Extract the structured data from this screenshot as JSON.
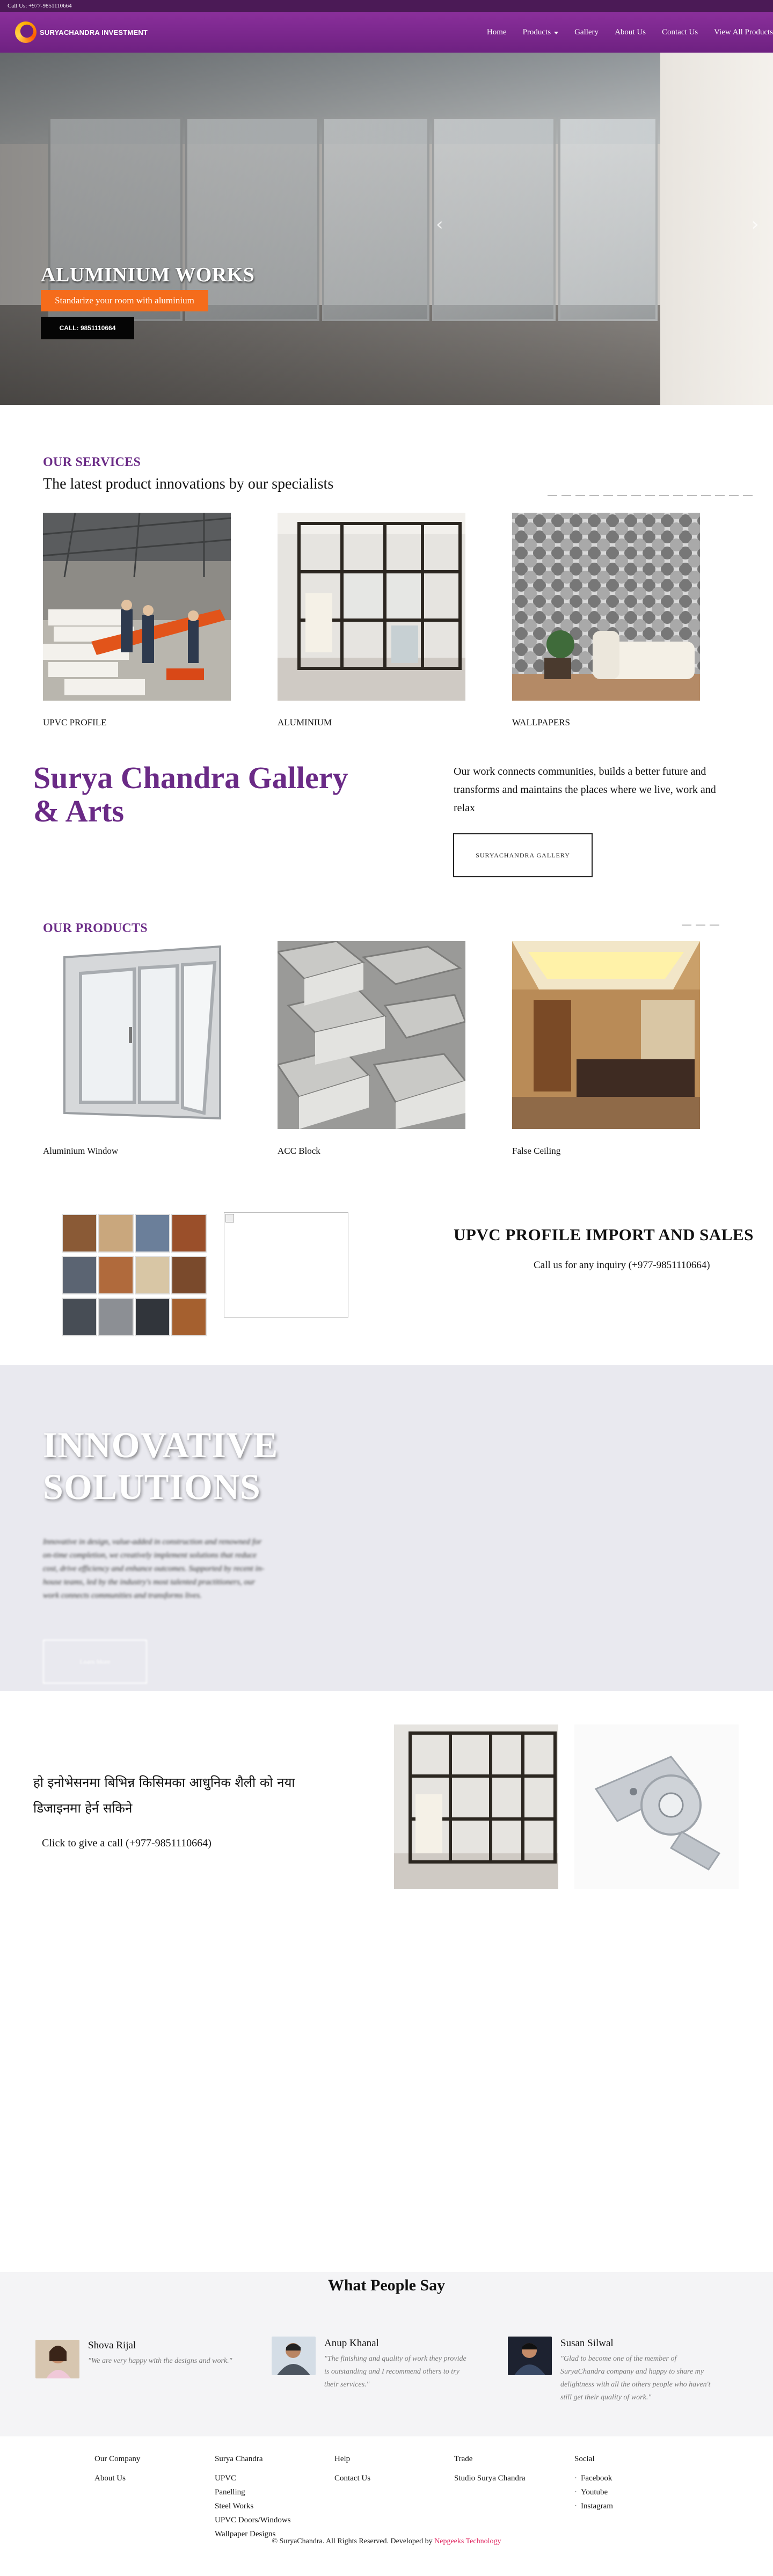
{
  "topbar": {
    "phone": "Call Us: +977-9851110664",
    "social": [
      "",
      "",
      "",
      "",
      "",
      "",
      ""
    ]
  },
  "header": {
    "logo_text": "SURYACHANDRA INVESTMENT",
    "nav": [
      "Home",
      "Products",
      "Gallery",
      "About Us",
      "Contact Us",
      "View All Products"
    ]
  },
  "hero": {
    "title": "ALUMINIUM WORKS",
    "tagline": "Standarize your room with aluminium",
    "call_label": "CALL: 9851110664",
    "prev": "‹",
    "next": "›"
  },
  "services": {
    "heading": "OUR SERVICES",
    "subheading": "The latest product innovations by our specialists",
    "items": [
      {
        "label": "UPVC PROFILE"
      },
      {
        "label": "ALUMINIUM"
      },
      {
        "label": "WALLPAPERS"
      }
    ]
  },
  "gallery": {
    "title": "Surya Chandra Gallery & Arts",
    "text": "Our work connects communities, builds a better future and transforms and maintains the places where we live, work and relax",
    "button": "SURYACHANDRA GALLERY"
  },
  "products": {
    "heading": "OUR PRODUCTS",
    "items": [
      {
        "label": "Aluminium Window"
      },
      {
        "label": "ACC Block"
      },
      {
        "label": "False Ceiling"
      }
    ]
  },
  "upvc": {
    "title": "UPVC PROFILE IMPORT AND SALES",
    "call": "Call us for any inquiry (+977-9851110664)",
    "phone_icon": ""
  },
  "innovative": {
    "title": "INNOVATIVE SOLUTIONS",
    "text": "Innovative in design, value-added in construction and renowned for on-time completion, we creatively implement solutions that reduce cost, drive efficiency and enhance outcomes. Supported by recent in-house teams, led by the industry's most talented practitioners, our work connects communities and transforms lives.",
    "button": "Learn More"
  },
  "devanagari": {
    "text": "हो इनोभेसनमा बिभिन्न किसिमका आधुनिक शैली को नया डिजाइनमा हेर्न सकिने",
    "call": "Click to give a call (+977-9851110664)",
    "phone_icon": ""
  },
  "testimonials": {
    "heading": "What People Say",
    "people": [
      {
        "name": "Shova Rijal",
        "quote": "\"We are very happy with the designs and work.\""
      },
      {
        "name": "Anup Khanal",
        "quote": "\"The finishing and quality of work they provide is outstanding and I recommend others to try their services.\""
      },
      {
        "name": "Susan Silwal",
        "quote": "\"Glad to become one of the member of SuryaChandra company and happy to share my delightness with all the others people who haven't still get their quality of work.\""
      }
    ]
  },
  "footer": {
    "columns": [
      {
        "heading": "Our Company",
        "links": [
          "About Us"
        ]
      },
      {
        "heading": "Surya Chandra",
        "links": [
          "UPVC",
          "Panelling",
          "Steel Works",
          "UPVC Doors/Windows",
          "Wallpaper Designs"
        ]
      },
      {
        "heading": "Help",
        "links": [
          "Contact Us"
        ]
      },
      {
        "heading": "Trade",
        "links": [
          "Studio Surya Chandra"
        ]
      },
      {
        "heading": "Social",
        "links": [
          "Facebook",
          "Youtube",
          "Instagram"
        ]
      }
    ],
    "copyright": "© SuryaChandra. All Rights Reserved. Developed by",
    "developer": "Nepgeeks Technology"
  },
  "colors": {
    "brand_purple": "#6e2181",
    "accent_orange": "#f56c1b",
    "developer_link": "#e0245e"
  }
}
